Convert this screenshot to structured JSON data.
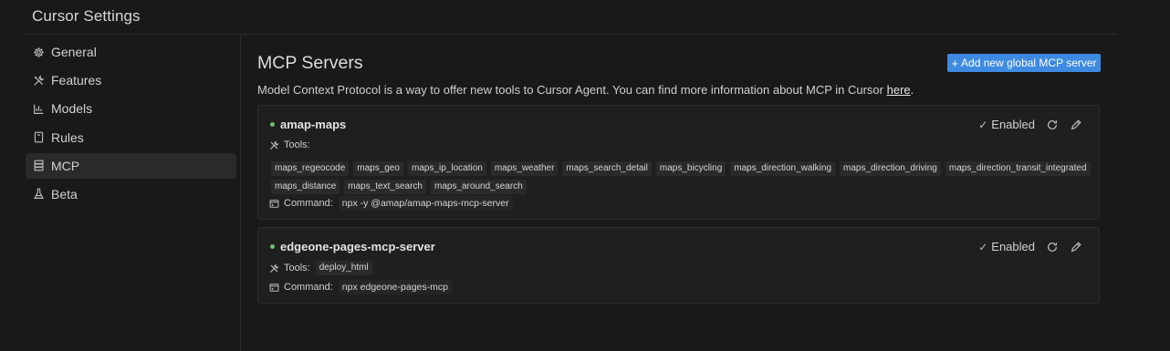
{
  "window": {
    "title": "Cursor Settings"
  },
  "sidebar": {
    "items": [
      {
        "label": "General",
        "icon": "gear-icon"
      },
      {
        "label": "Features",
        "icon": "tools-icon"
      },
      {
        "label": "Models",
        "icon": "chart-icon"
      },
      {
        "label": "Rules",
        "icon": "document-icon"
      },
      {
        "label": "MCP",
        "icon": "server-icon",
        "active": true
      },
      {
        "label": "Beta",
        "icon": "flask-icon"
      }
    ]
  },
  "main": {
    "title": "MCP Servers",
    "add_button": "Add new global MCP server",
    "description": "Model Context Protocol is a way to offer new tools to Cursor Agent. You can find more information about MCP in Cursor ",
    "description_link": "here",
    "description_end": "."
  },
  "servers": [
    {
      "name": "amap-maps",
      "status": "Enabled",
      "tools_label": "Tools:",
      "tools": [
        "maps_regeocode",
        "maps_geo",
        "maps_ip_location",
        "maps_weather",
        "maps_search_detail",
        "maps_bicycling",
        "maps_direction_walking",
        "maps_direction_driving",
        "maps_direction_transit_integrated",
        "maps_distance",
        "maps_text_search",
        "maps_around_search"
      ],
      "command_label": "Command:",
      "command": "npx -y @amap/amap-maps-mcp-server"
    },
    {
      "name": "edgeone-pages-mcp-server",
      "status": "Enabled",
      "tools_label": "Tools:",
      "tools": [
        "deploy_html"
      ],
      "command_label": "Command:",
      "command": "npx edgeone-pages-mcp"
    }
  ],
  "colors": {
    "accent": "#3d8ae0",
    "status_ok": "#6fbf73",
    "background": "#191919"
  }
}
